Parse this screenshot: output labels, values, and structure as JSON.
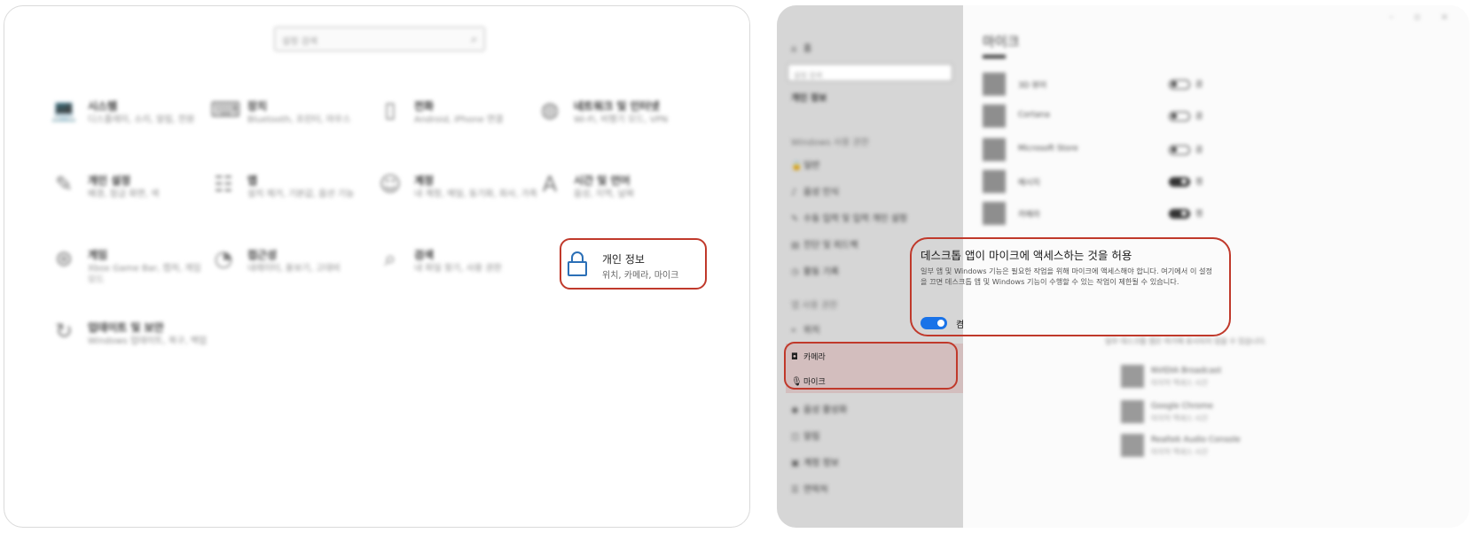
{
  "left": {
    "search_placeholder": "설정 검색",
    "tiles": [
      {
        "icon": "laptop-icon",
        "title": "시스템",
        "desc": "디스플레이, 소리, 알림, 전원"
      },
      {
        "icon": "devices-icon",
        "title": "장치",
        "desc": "Bluetooth, 프린터, 마우스"
      },
      {
        "icon": "phone-icon",
        "title": "전화",
        "desc": "Android, iPhone 연결"
      },
      {
        "icon": "globe-icon",
        "title": "네트워크 및 인터넷",
        "desc": "Wi-Fi, 비행기 모드, VPN"
      },
      {
        "icon": "brush-icon",
        "title": "개인 설정",
        "desc": "배경, 잠금 화면, 색"
      },
      {
        "icon": "apps-icon",
        "title": "앱",
        "desc": "설치 제거, 기본값, 옵션 기능"
      },
      {
        "icon": "person-icon",
        "title": "계정",
        "desc": "내 계정, 메일, 동기화, 회사, 가족"
      },
      {
        "icon": "language-icon",
        "title": "시간 및 언어",
        "desc": "음성, 지역, 날짜"
      },
      {
        "icon": "gamepad-icon",
        "title": "게임",
        "desc": "Xbox Game Bar, 캡처, 게임 모드"
      },
      {
        "icon": "accessibility-icon",
        "title": "접근성",
        "desc": "내레이터, 돋보기, 고대비"
      },
      {
        "icon": "search-icon",
        "title": "검색",
        "desc": "내 파일 찾기, 사용 권한"
      },
      {
        "icon": "update-icon",
        "title": "업데이트 및 보안",
        "desc": "Windows 업데이트, 복구, 백업"
      }
    ],
    "privacy": {
      "title": "개인 정보",
      "desc": "위치, 카메라, 마이크"
    }
  },
  "right": {
    "sidebar": {
      "home": "홈",
      "search": "설정 검색",
      "section1_header": "개인 정보",
      "items_top": [
        "Windows 사용 권한",
        "일반",
        "음성 인식",
        "수동 입력 및 입력 개인 설정",
        "진단 및 피드백",
        "활동 기록"
      ],
      "section2_header": "앱 사용 권한",
      "item_location": "위치",
      "camera_label": "카메라",
      "mic_label": "마이크",
      "items_bottom": [
        "음성 활성화",
        "알림",
        "계정 정보",
        "연락처"
      ]
    },
    "content": {
      "page_title": "마이크",
      "apps": [
        {
          "name": "3D 뷰어",
          "state": "끔",
          "on": false
        },
        {
          "name": "Cortana",
          "state": "끔",
          "on": false
        },
        {
          "name": "Microsoft Store",
          "state": "끔",
          "on": false
        },
        {
          "name": "메시지",
          "state": "켬",
          "on": true
        },
        {
          "name": "카메라",
          "state": "켬",
          "on": true
        }
      ],
      "desktop_title": "데스크톱 앱이 마이크에 액세스하는 것을 허용",
      "desktop_desc": "일부 앱 및 Windows 기능은 필요한 작업을 위해 마이크에 액세스해야 합니다. 여기에서 이 설정을 끄면 데스크톱 앱 및 Windows 기능이 수행할 수 있는 작업이 제한될 수 있습니다.",
      "toggle_label": "켬",
      "note": "일부 데스크톱 앱은 여기에 표시되지 않을 수 있습니다.",
      "desktop_apps": [
        {
          "name": "NVIDIA Broadcast",
          "last": "마지막 액세스 시간"
        },
        {
          "name": "Google Chrome",
          "last": "마지막 액세스 시간"
        },
        {
          "name": "Realtek Audio Console",
          "last": "마지막 액세스 시간"
        }
      ]
    }
  },
  "colors": {
    "highlight": "#c0392b",
    "toggle_on": "#1a73e8",
    "sidebar_bg": "#d6d6d6"
  }
}
